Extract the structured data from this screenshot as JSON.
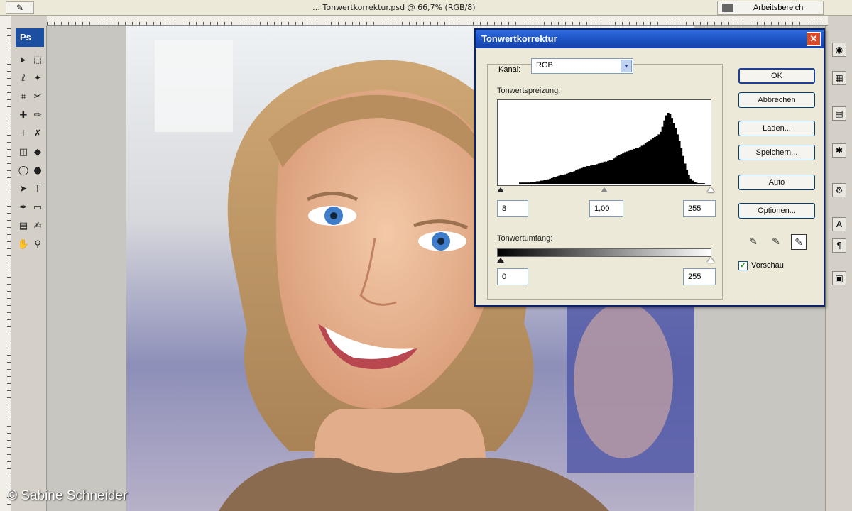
{
  "options_bar": {
    "tool_glyph": "✎",
    "document_info": "… Tonwertkorrektur.psd @ 66,7% (RGB/8)",
    "workspace_label": "Arbeitsbereich"
  },
  "toolbox": {
    "logo": "Ps",
    "tools": [
      {
        "glyph": "▸",
        "icon": "move-icon"
      },
      {
        "glyph": "⬚",
        "icon": "marquee-icon"
      },
      {
        "glyph": "ℓ",
        "icon": "lasso-icon"
      },
      {
        "glyph": "✦",
        "icon": "magic-wand-icon"
      },
      {
        "glyph": "⌗",
        "icon": "crop-icon"
      },
      {
        "glyph": "✂",
        "icon": "slice-icon"
      },
      {
        "glyph": "✚",
        "icon": "healing-brush-icon"
      },
      {
        "glyph": "✏",
        "icon": "brush-icon"
      },
      {
        "glyph": "⊥",
        "icon": "clone-stamp-icon"
      },
      {
        "glyph": "✗",
        "icon": "history-brush-icon"
      },
      {
        "glyph": "◫",
        "icon": "eraser-icon"
      },
      {
        "glyph": "◆",
        "icon": "paint-bucket-icon"
      },
      {
        "glyph": "◯",
        "icon": "blur-icon"
      },
      {
        "glyph": "●",
        "icon": "dodge-icon"
      },
      {
        "glyph": "➤",
        "icon": "path-selection-icon"
      },
      {
        "glyph": "T",
        "icon": "type-icon"
      },
      {
        "glyph": "✒",
        "icon": "pen-icon"
      },
      {
        "glyph": "▭",
        "icon": "shape-icon"
      },
      {
        "glyph": "▤",
        "icon": "notes-icon"
      },
      {
        "glyph": "✍",
        "icon": "eyedropper-icon"
      },
      {
        "glyph": "✋",
        "icon": "hand-icon"
      },
      {
        "glyph": "⚲",
        "icon": "zoom-icon"
      }
    ]
  },
  "dialog": {
    "title": "Tonwertkorrektur",
    "close_glyph": "✕",
    "channel_label": "Kanal:",
    "channel_value": "RGB",
    "channel_arrow": "▾",
    "input_levels_label": "Tonwertspreizung:",
    "input_black": "8",
    "input_gamma": "1,00",
    "input_white": "255",
    "output_levels_label": "Tonwertumfang:",
    "output_black": "0",
    "output_white": "255",
    "buttons": {
      "ok": "OK",
      "cancel": "Abbrechen",
      "load": "Laden...",
      "save": "Speichern...",
      "auto": "Auto",
      "options": "Optionen..."
    },
    "eyedroppers": [
      "✎",
      "✎",
      "✎"
    ],
    "preview_checked": "✓",
    "preview_label": "Vorschau",
    "histogram": [
      2,
      2,
      2,
      2,
      2,
      2,
      3,
      3,
      3,
      4,
      4,
      5,
      5,
      6,
      6,
      7,
      8,
      9,
      10,
      11,
      12,
      13,
      14,
      14,
      15,
      16,
      17,
      18,
      19,
      20,
      22,
      23,
      24,
      25,
      26,
      27,
      28,
      28,
      29,
      30,
      30,
      31,
      32,
      33,
      34,
      35,
      35,
      36,
      37,
      38,
      40,
      42,
      44,
      45,
      47,
      48,
      50,
      51,
      52,
      53,
      54,
      55,
      56,
      57,
      58,
      60,
      62,
      64,
      66,
      68,
      70,
      72,
      74,
      76,
      78,
      82,
      90,
      100,
      108,
      112,
      110,
      104,
      96,
      88,
      78,
      68,
      56,
      44,
      32,
      22,
      14,
      8,
      5,
      3,
      2,
      1,
      1,
      1,
      1,
      0
    ]
  },
  "credit": "© Sabine Schneider"
}
